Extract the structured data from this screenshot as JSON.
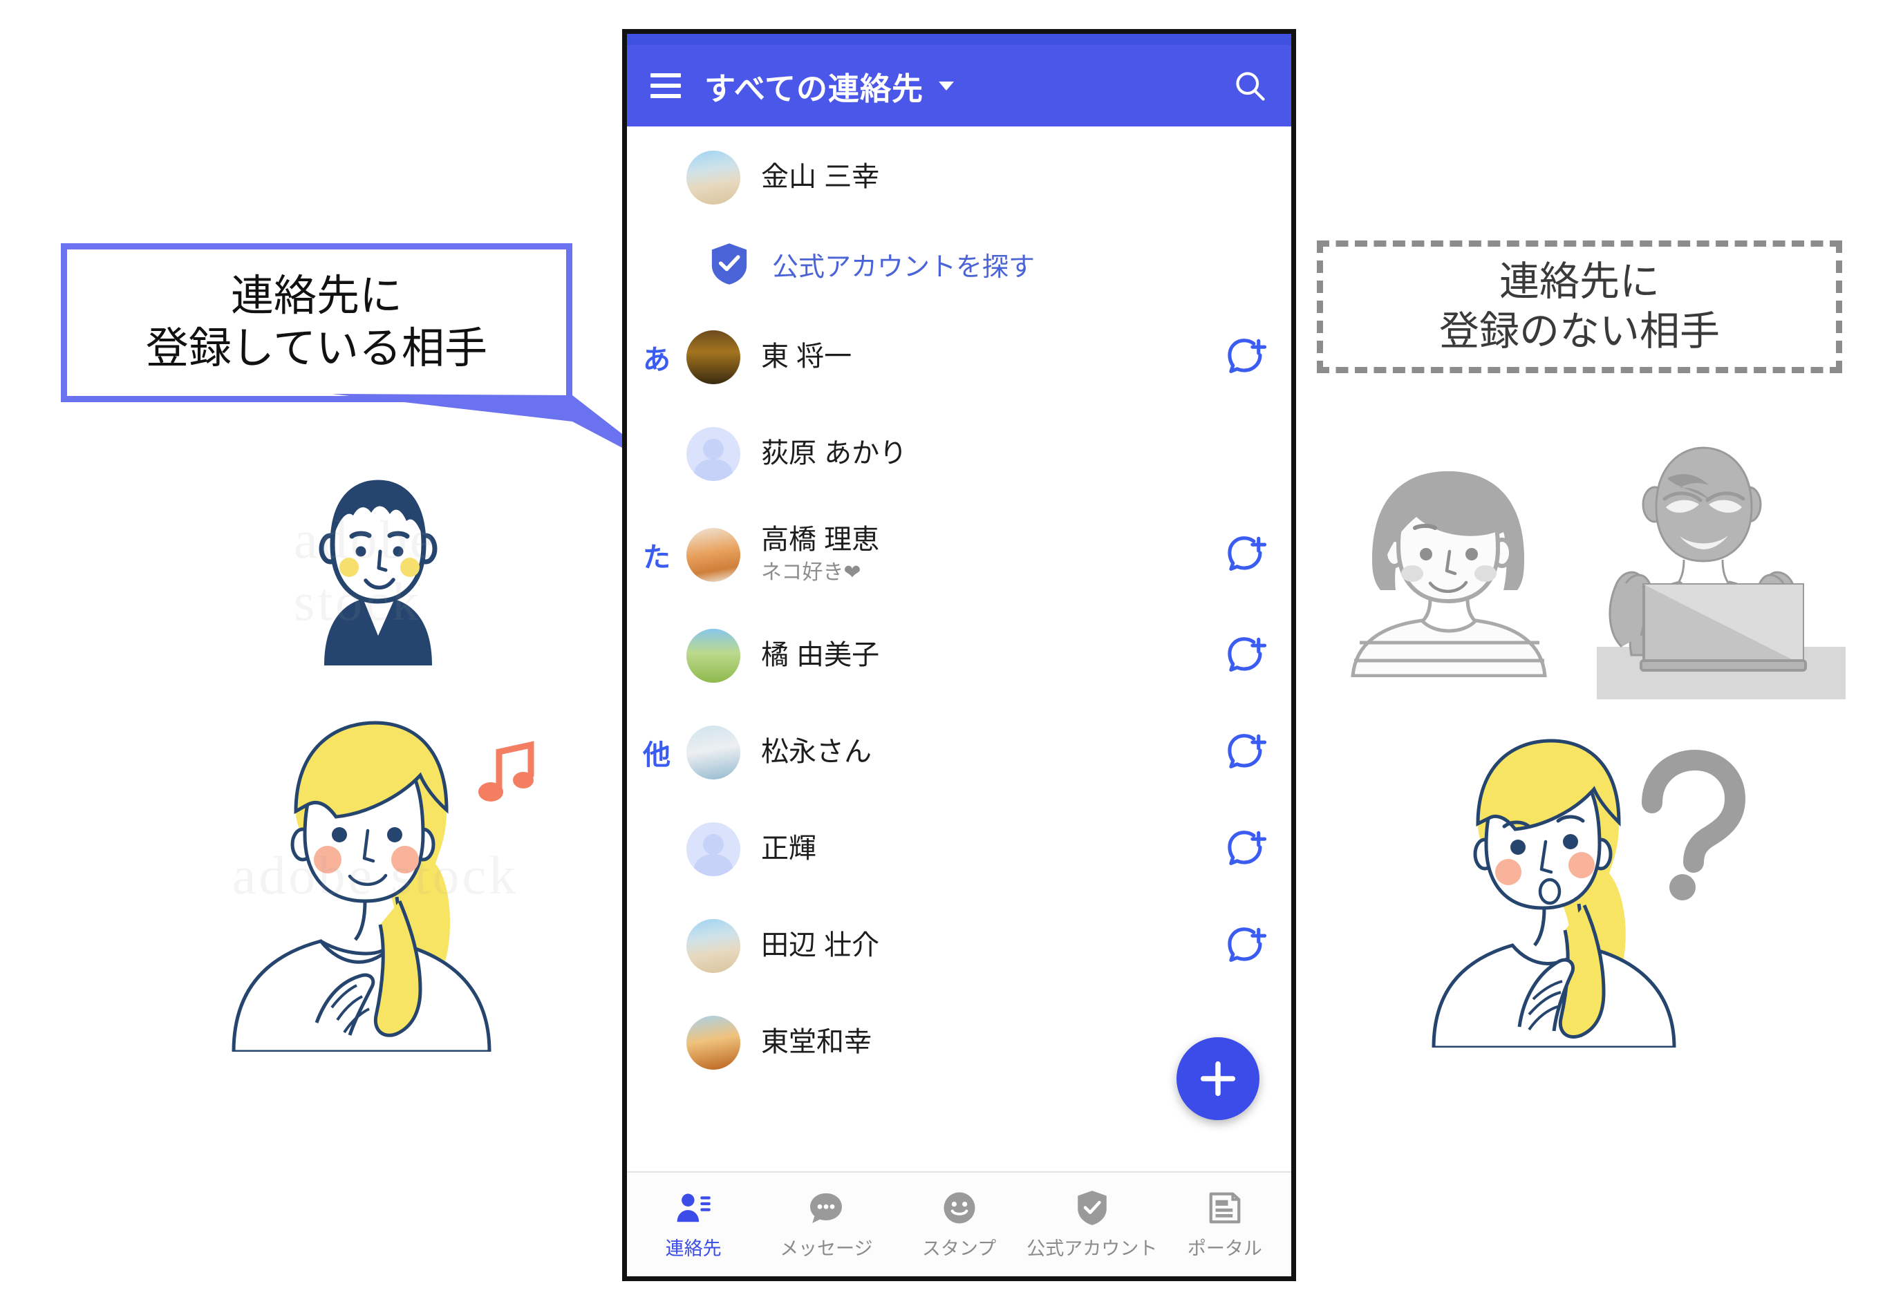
{
  "phone": {
    "appbar": {
      "menu_icon": "hamburger-menu-icon",
      "title": "すべての連絡先",
      "dropdown_icon": "chevron-down-icon",
      "search_icon": "search-icon"
    },
    "official_row": {
      "icon": "verified-shield-icon",
      "label": "公式アカウントを探す"
    },
    "contacts": [
      {
        "index": "",
        "name": "金山 三幸",
        "status": "",
        "avatar": "photo-balloons",
        "add_icon": ""
      },
      {
        "index": "あ",
        "name": "東 将一",
        "status": "",
        "avatar": "photo-night",
        "add_icon": "add-chat-icon"
      },
      {
        "index": "",
        "name": "荻原 あかり",
        "status": "",
        "avatar": "default-avatar",
        "add_icon": ""
      },
      {
        "index": "た",
        "name": "高橋 理恵",
        "status": "ネコ好き❤",
        "avatar": "photo-cat",
        "add_icon": "add-chat-icon"
      },
      {
        "index": "",
        "name": "橘 由美子",
        "status": "",
        "avatar": "photo-field",
        "add_icon": "add-chat-icon"
      },
      {
        "index": "他",
        "name": "松永さん",
        "status": "",
        "avatar": "photo-plane",
        "add_icon": "add-chat-icon"
      },
      {
        "index": "",
        "name": "正輝",
        "status": "",
        "avatar": "default-avatar",
        "add_icon": "add-chat-icon"
      },
      {
        "index": "",
        "name": "田辺 壮介",
        "status": "",
        "avatar": "photo-balloons",
        "add_icon": "add-chat-icon"
      },
      {
        "index": "",
        "name": "東堂和幸",
        "status": "",
        "avatar": "photo-sunset",
        "add_icon": ""
      }
    ],
    "fab": {
      "icon": "plus-icon",
      "label": ""
    },
    "tabs": [
      {
        "label": "連絡先",
        "icon": "contacts-icon",
        "active": true
      },
      {
        "label": "メッセージ",
        "icon": "chat-bubble-icon",
        "active": false
      },
      {
        "label": "スタンプ",
        "icon": "smiley-icon",
        "active": false
      },
      {
        "label": "公式アカウント",
        "icon": "verified-shield-icon",
        "active": false
      },
      {
        "label": "ポータル",
        "icon": "portal-page-icon",
        "active": false
      }
    ]
  },
  "callouts": {
    "left": {
      "line1": "連絡先に",
      "line2": "登録している相手"
    },
    "right": {
      "line1": "連絡先に",
      "line2": "登録のない相手"
    }
  },
  "illustrations": {
    "man_registered": "smiling-man-illustration",
    "woman_registered": "blonde-woman-music-note-illustration",
    "woman_unknown": "gray-bob-woman-illustration",
    "stranger_laptop": "gray-sinister-laptop-illustration",
    "woman_confused": "blonde-woman-question-mark-illustration",
    "watermark": "adobe stock"
  },
  "colors": {
    "accent_blue": "#4a57e8",
    "link_blue": "#4a63d6",
    "index_blue": "#3b5cf0",
    "callout_left_border": "#6b72f0",
    "callout_right_border": "#8c8c8c"
  }
}
